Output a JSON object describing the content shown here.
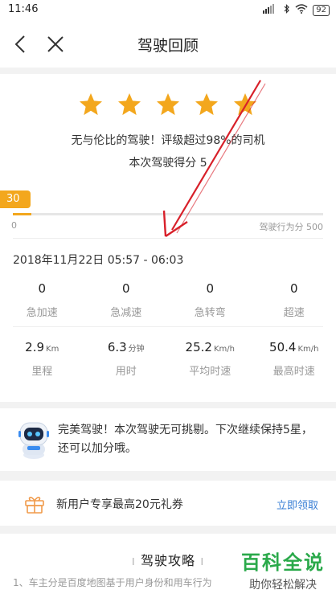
{
  "status": {
    "time": "11:46",
    "battery": "92"
  },
  "nav": {
    "title": "驾驶回顾"
  },
  "rating": {
    "stars_filled": 5,
    "stars_total": 5,
    "star_color": "#f3a71d",
    "praise": "无与伦比的驾驶！评级超过98%的司机",
    "score_line": "本次驾驶得分 5"
  },
  "behavior": {
    "badge": "30",
    "current": 30,
    "min_label": "0",
    "max_label": "驾驶行为分 500",
    "max": 500
  },
  "trip": {
    "time_range": "2018年11月22日 05:57 - 06:03",
    "events": [
      {
        "value": "0",
        "label": "急加速"
      },
      {
        "value": "0",
        "label": "急减速"
      },
      {
        "value": "0",
        "label": "急转弯"
      },
      {
        "value": "0",
        "label": "超速"
      }
    ],
    "stats": [
      {
        "value": "2.9",
        "unit": "Km",
        "label": "里程"
      },
      {
        "value": "6.3",
        "unit": "分钟",
        "label": "用时"
      },
      {
        "value": "25.2",
        "unit": "Km/h",
        "label": "平均时速"
      },
      {
        "value": "50.4",
        "unit": "Km/h",
        "label": "最高时速"
      }
    ]
  },
  "tip": {
    "text": "完美驾驶！本次驾驶无可挑剔。下次继续保持5星，还可以加分哦。"
  },
  "coupon": {
    "text": "新用户专享最高20元礼券",
    "action": "立即领取",
    "action_color": "#3a7fd5"
  },
  "guide": {
    "title": "驾驶攻略",
    "text": "1、车主分是百度地图基于用户身份和用车行为"
  },
  "watermark": {
    "title": "百科全说",
    "subtitle": "助你轻松解决",
    "color": "#2aa94a"
  },
  "annotation_color": "#d8202a"
}
